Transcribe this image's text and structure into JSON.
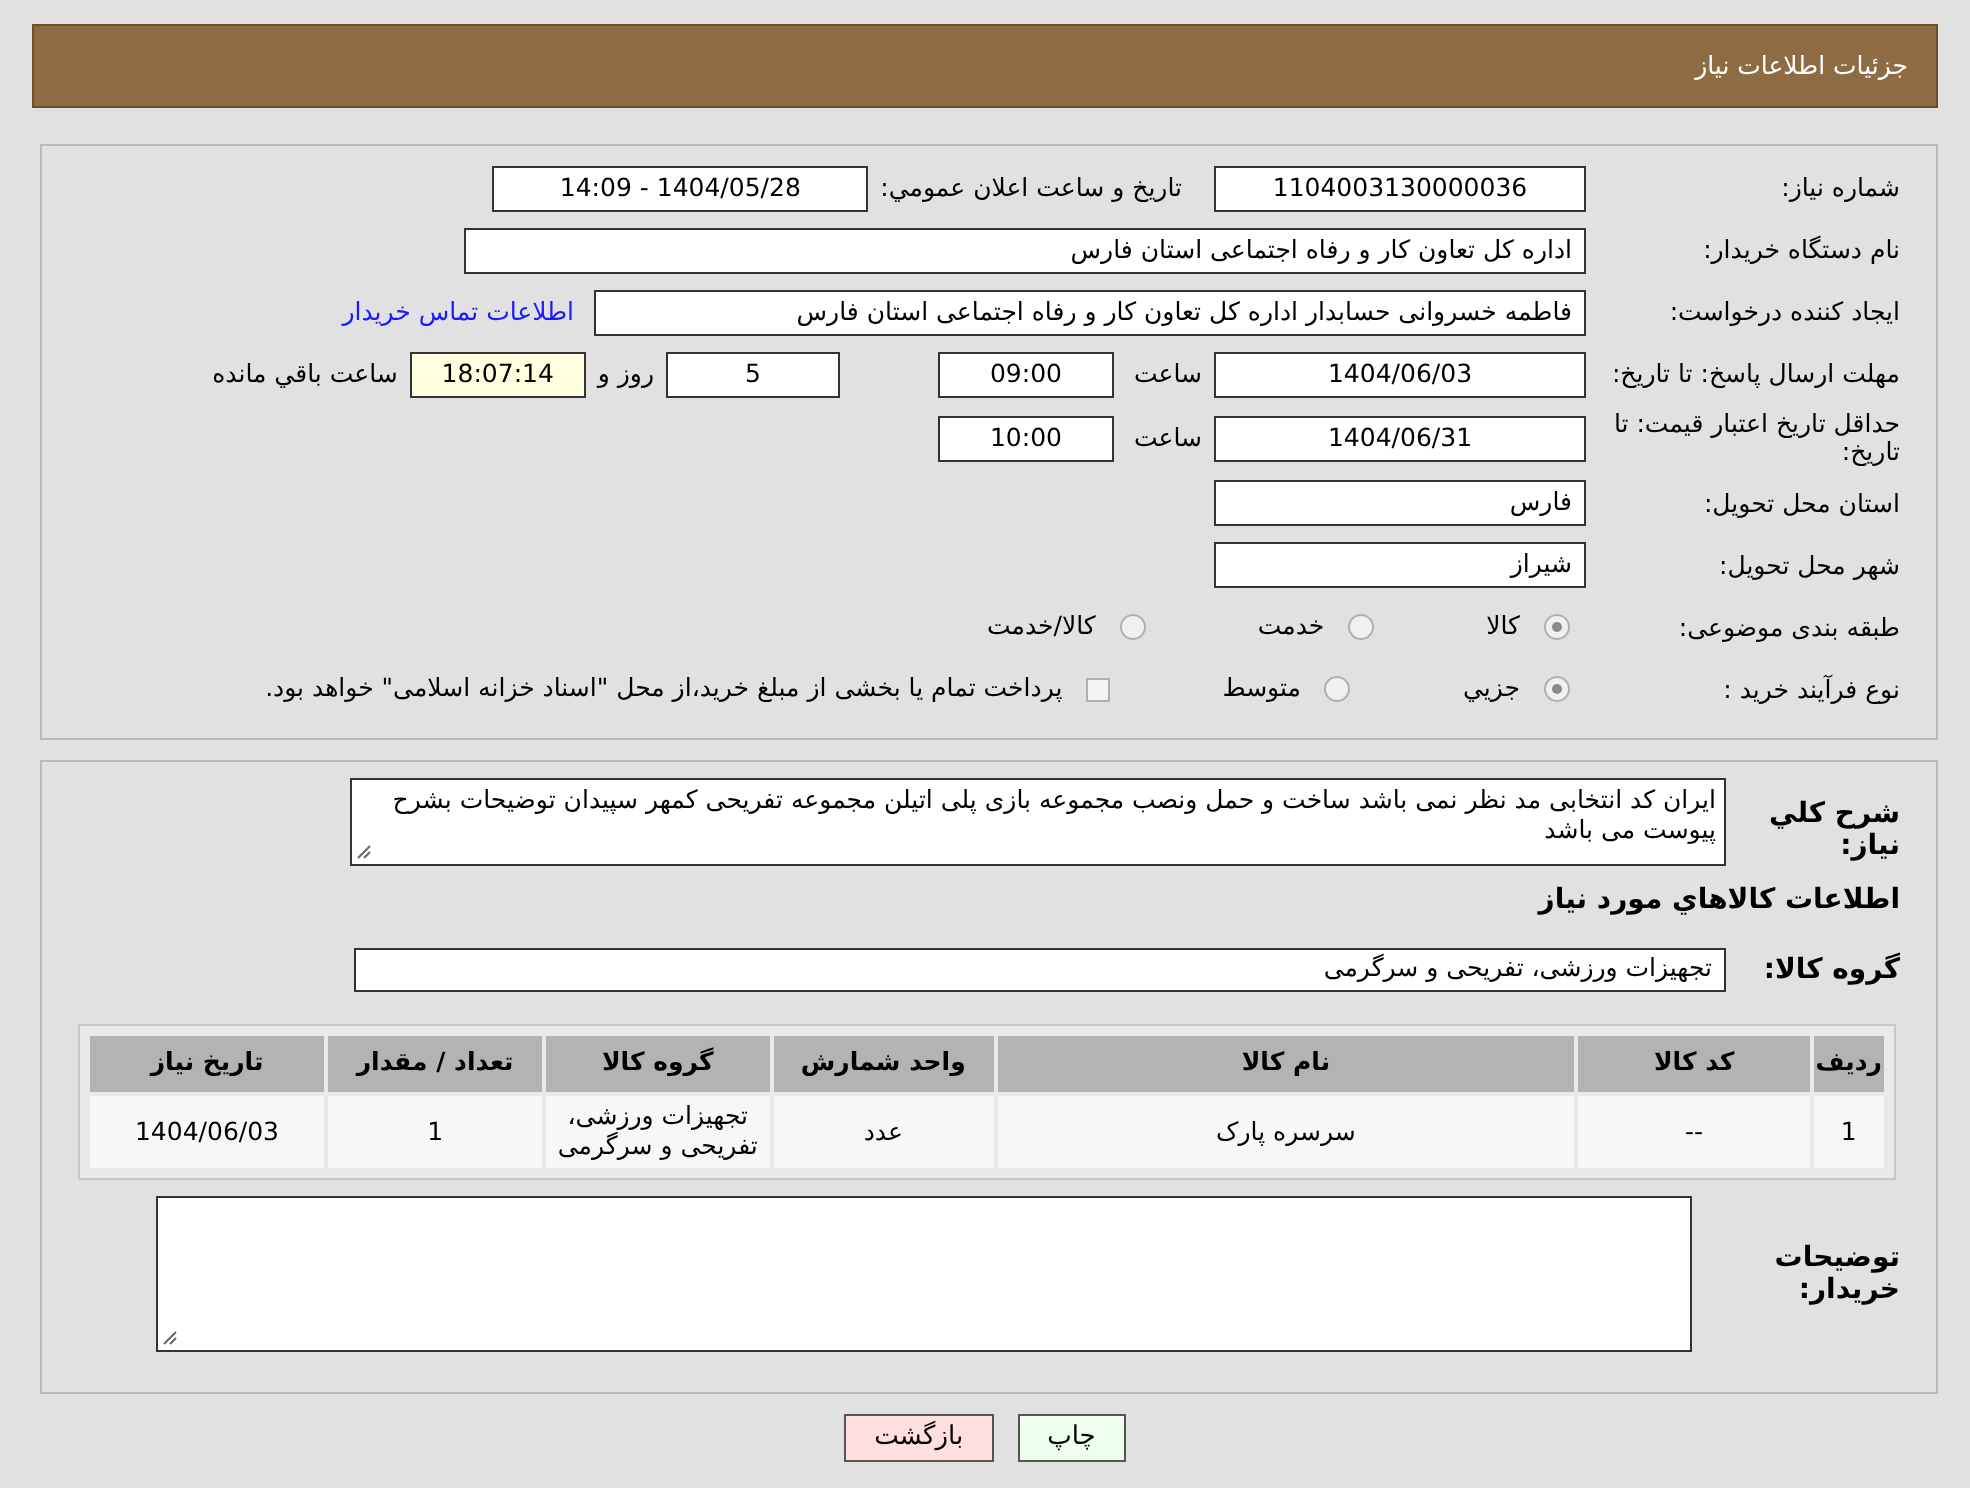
{
  "header": {
    "title": "جزئیات اطلاعات نیاز"
  },
  "details": {
    "need_number": {
      "label": "شماره نیاز:",
      "value": "1104003130000036"
    },
    "announce": {
      "label": "تاریخ و ساعت اعلان عمومي:",
      "value": "1404/05/28 - 14:09"
    },
    "buyer_org": {
      "label": "نام دستگاه خریدار:",
      "value": "اداره کل تعاون  کار و رفاه اجتماعی استان فارس"
    },
    "creator": {
      "label": "ایجاد کننده درخواست:",
      "value": "فاطمه خسروانی حسابدار اداره کل تعاون  کار و رفاه اجتماعی استان فارس",
      "link": "اطلاعات تماس خریدار"
    },
    "deadline": {
      "label": "مهلت ارسال پاسخ: تا تاریخ:",
      "date": "1404/06/03",
      "time_label": "ساعت",
      "time": "09:00",
      "days": "5",
      "days_label": "روز و",
      "remaining": "18:07:14",
      "remaining_label": "ساعت باقي مانده"
    },
    "validity": {
      "label": "حداقل تاریخ اعتبار قیمت: تا تاریخ:",
      "date": "1404/06/31",
      "time_label": "ساعت",
      "time": "10:00"
    },
    "province": {
      "label": "استان محل تحویل:",
      "value": "فارس"
    },
    "city": {
      "label": "شهر محل تحویل:",
      "value": "شیراز"
    },
    "category": {
      "label": "طبقه بندی موضوعی:",
      "options": [
        {
          "label": "کالا",
          "selected": true
        },
        {
          "label": "خدمت",
          "selected": false
        },
        {
          "label": "کالا/خدمت",
          "selected": false
        }
      ]
    },
    "process": {
      "label": "نوع فرآیند خرید :",
      "options": [
        {
          "kind": "radio",
          "label": "جزيي",
          "selected": true
        },
        {
          "kind": "radio",
          "label": "متوسط",
          "selected": false
        },
        {
          "kind": "checkbox",
          "label": "پرداخت تمام یا بخشی از مبلغ خرید،از محل \"اسناد خزانه اسلامی\" خواهد بود.",
          "selected": false
        }
      ]
    }
  },
  "summary": {
    "label": "شرح كلي نیاز:",
    "value": "ایران کد انتخابی مد نظر نمی باشد ساخت و حمل ونصب مجموعه بازی پلی اتیلن مجموعه تفریحی کمهر سپیدان توضیحات بشرح پیوست می باشد",
    "goods_heading": "اطلاعات كالاهاي مورد نیاز",
    "group": {
      "label": "گروه کالا:",
      "value": "تجهیزات ورزشی، تفریحی و سرگرمی"
    }
  },
  "table": {
    "columns": [
      "ردیف",
      "کد کالا",
      "نام کالا",
      "واحد شمارش",
      "گروه کالا",
      "تعداد / مقدار",
      "تاریخ نیاز"
    ],
    "rows": [
      [
        "1",
        "--",
        "سرسره پارک",
        "عدد",
        "تجهیزات ورزشی، تفریحی و سرگرمی",
        "1",
        "1404/06/03"
      ]
    ]
  },
  "buyer_notes": {
    "label": "توضیحات خریدار:"
  },
  "buttons": [
    {
      "kind": "print",
      "label": "چاپ"
    },
    {
      "kind": "back",
      "label": "بازگشت"
    }
  ]
}
